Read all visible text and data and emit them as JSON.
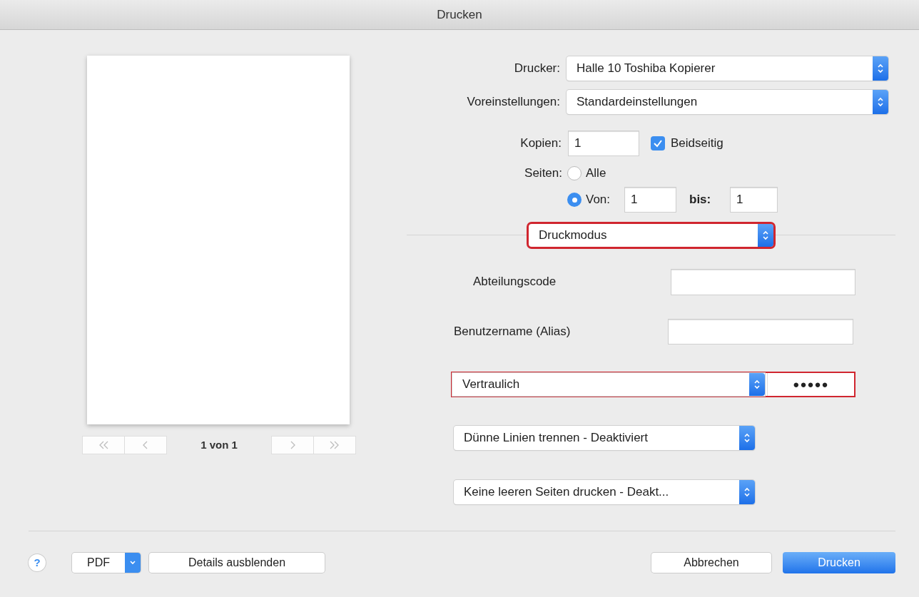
{
  "window": {
    "title": "Drucken"
  },
  "preview": {
    "page_label": "1 von 1",
    "nav_buttons": [
      {
        "kind": "first",
        "disabled": true
      },
      {
        "kind": "previous",
        "disabled": true
      },
      {
        "kind": "next",
        "disabled": true
      },
      {
        "kind": "last",
        "disabled": true
      }
    ]
  },
  "printer": {
    "label": "Drucker:",
    "value": "Halle 10 Toshiba Kopierer"
  },
  "presets": {
    "label": "Voreinstellungen:",
    "value": "Standardeinstellungen"
  },
  "copies": {
    "label": "Kopien:",
    "value": "1"
  },
  "two_sided": {
    "label": "Beidseitig",
    "checked": true
  },
  "pages": {
    "label": "Seiten:",
    "options": [
      {
        "label": "Alle",
        "selected": false
      },
      {
        "label": "Von:",
        "selected": true
      }
    ],
    "from": "1",
    "to_label": "bis:",
    "to": "1"
  },
  "section_menu": {
    "value": "Druckmodus",
    "highlighted": true
  },
  "fields": [
    {
      "label": "Abteilungscode"
    },
    {
      "label": "Benutzername (Alias)"
    }
  ],
  "confidential": {
    "value": "Vertraulich",
    "password": "●●●●●",
    "highlighted": true
  },
  "menus": [
    {
      "value": "Dünne Linien trennen - Deaktiviert"
    },
    {
      "value": "Keine leeren Seiten drucken - Deakt..."
    }
  ],
  "footer": {
    "help": "?",
    "pdf": "PDF",
    "details": "Details ausblenden",
    "cancel": "Abbrechen",
    "print": "Drucken"
  }
}
